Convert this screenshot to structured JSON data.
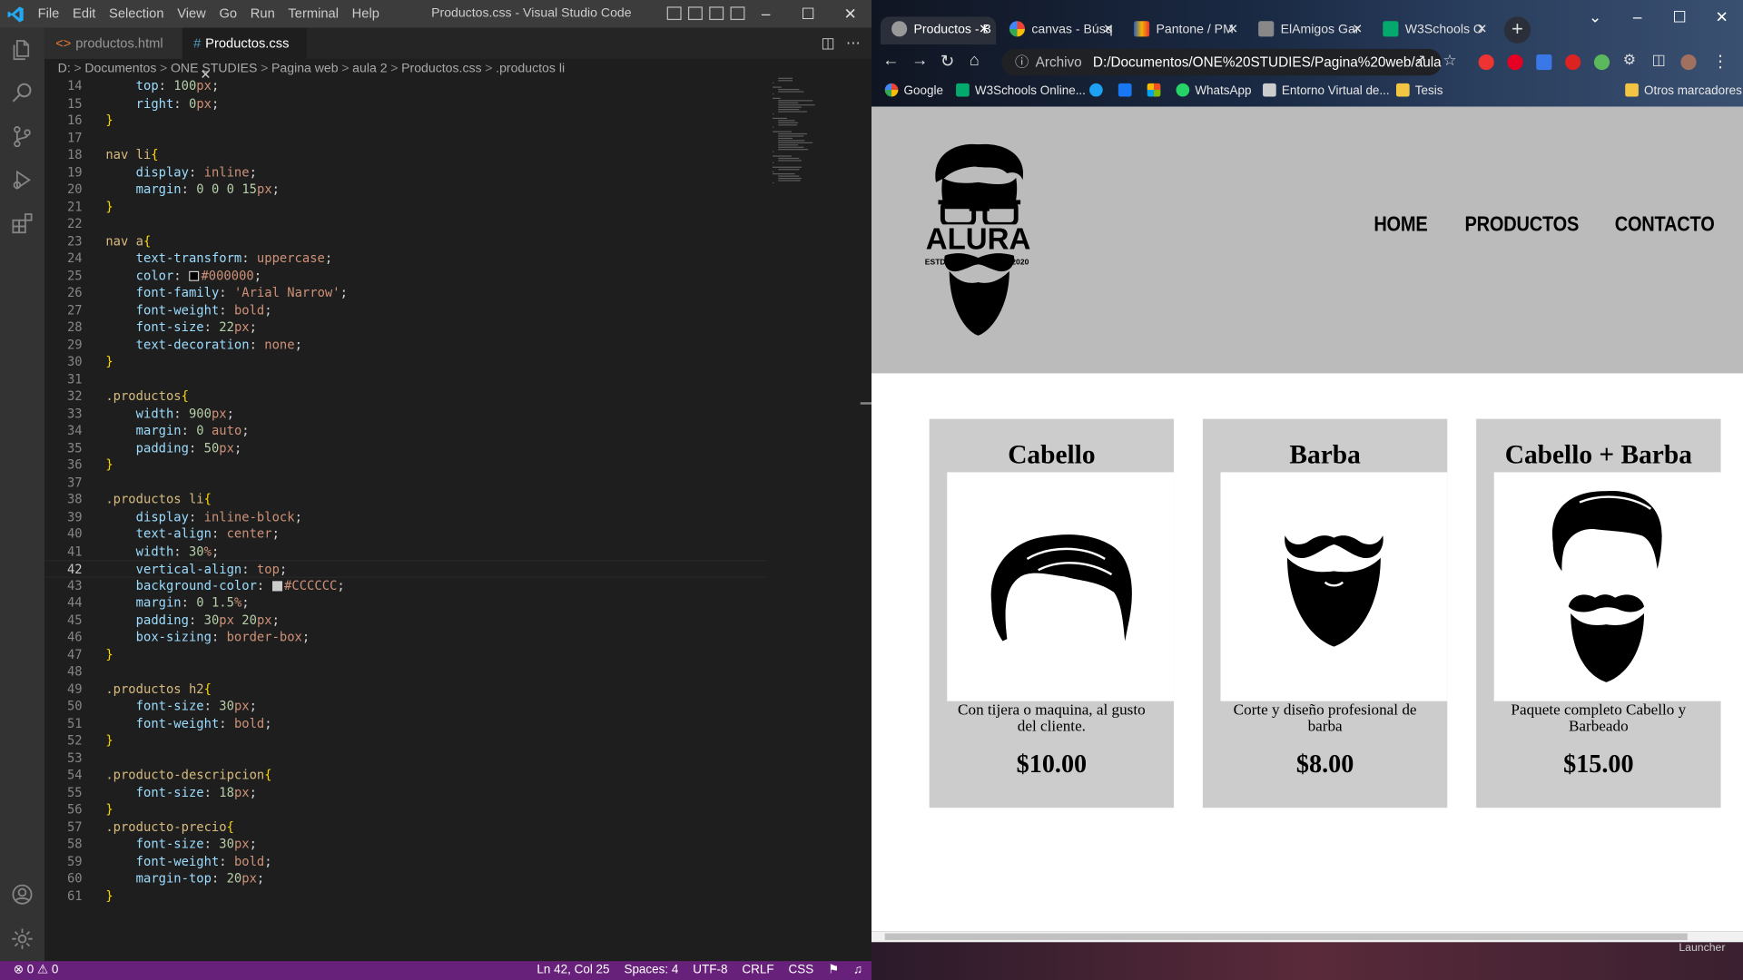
{
  "vscode": {
    "menu": [
      "File",
      "Edit",
      "Selection",
      "View",
      "Go",
      "Run",
      "Terminal",
      "Help"
    ],
    "window_title": "Productos.css - Visual Studio Code",
    "tabs": [
      {
        "label": "productos.html"
      },
      {
        "label": "Productos.css"
      }
    ],
    "breadcrumb": [
      "D:",
      "Documentos",
      "ONE STUDIES",
      "Pagina web",
      "aula 2",
      "Productos.css",
      ".productos li"
    ],
    "code": [
      {
        "n": "14",
        "text": "    top: 100px;"
      },
      {
        "n": "15",
        "text": "    right: 0px;"
      },
      {
        "n": "16",
        "text": "}"
      },
      {
        "n": "17",
        "text": ""
      },
      {
        "n": "18",
        "text": "nav li{"
      },
      {
        "n": "19",
        "text": "    display: inline;"
      },
      {
        "n": "20",
        "text": "    margin: 0 0 0 15px;"
      },
      {
        "n": "21",
        "text": "}"
      },
      {
        "n": "22",
        "text": ""
      },
      {
        "n": "23",
        "text": "nav a{"
      },
      {
        "n": "24",
        "text": "    text-transform: uppercase;"
      },
      {
        "n": "25",
        "text": "    color: #000000;"
      },
      {
        "n": "26",
        "text": "    font-family: 'Arial Narrow';"
      },
      {
        "n": "27",
        "text": "    font-weight: bold;"
      },
      {
        "n": "28",
        "text": "    font-size: 22px;"
      },
      {
        "n": "29",
        "text": "    text-decoration: none;"
      },
      {
        "n": "30",
        "text": "}"
      },
      {
        "n": "31",
        "text": ""
      },
      {
        "n": "32",
        "text": ".productos{"
      },
      {
        "n": "33",
        "text": "    width: 900px;"
      },
      {
        "n": "34",
        "text": "    margin: 0 auto;"
      },
      {
        "n": "35",
        "text": "    padding: 50px;"
      },
      {
        "n": "36",
        "text": "}"
      },
      {
        "n": "37",
        "text": ""
      },
      {
        "n": "38",
        "text": ".productos li{"
      },
      {
        "n": "39",
        "text": "    display: inline-block;"
      },
      {
        "n": "40",
        "text": "    text-align: center;"
      },
      {
        "n": "41",
        "text": "    width: 30%;"
      },
      {
        "n": "42",
        "text": "    vertical-align: top;"
      },
      {
        "n": "43",
        "text": "    background-color: #CCCCCC;"
      },
      {
        "n": "44",
        "text": "    margin: 0 1.5%;"
      },
      {
        "n": "45",
        "text": "    padding: 30px 20px;"
      },
      {
        "n": "46",
        "text": "    box-sizing: border-box;"
      },
      {
        "n": "47",
        "text": "}"
      },
      {
        "n": "48",
        "text": ""
      },
      {
        "n": "49",
        "text": ".productos h2{"
      },
      {
        "n": "50",
        "text": "    font-size: 30px;"
      },
      {
        "n": "51",
        "text": "    font-weight: bold;"
      },
      {
        "n": "52",
        "text": "}"
      },
      {
        "n": "53",
        "text": ""
      },
      {
        "n": "54",
        "text": ".producto-descripcion{"
      },
      {
        "n": "55",
        "text": "    font-size: 18px;"
      },
      {
        "n": "56",
        "text": "}"
      },
      {
        "n": "57",
        "text": ".producto-precio{"
      },
      {
        "n": "58",
        "text": "    font-size: 30px;"
      },
      {
        "n": "59",
        "text": "    font-weight: bold;"
      },
      {
        "n": "60",
        "text": "    margin-top: 20px;"
      },
      {
        "n": "61",
        "text": "}"
      }
    ],
    "current_line": "42",
    "status": {
      "errors": "0",
      "warnings": "0",
      "position": "Ln 42, Col 25",
      "spaces": "Spaces: 4",
      "encoding": "UTF-8",
      "eol": "CRLF",
      "language": "CSS"
    },
    "colors": {
      "statusbar": "#68217a",
      "editor_bg": "#1e1e1e"
    }
  },
  "chrome": {
    "tabs": [
      {
        "label": "Productos - B"
      },
      {
        "label": "canvas - Búsq"
      },
      {
        "label": "Pantone / PM"
      },
      {
        "label": "ElAmigos Gar"
      },
      {
        "label": "W3Schools O"
      }
    ],
    "address": {
      "scheme_label": "Archivo",
      "url": "D:/Documentos/ONE%20STUDIES/Pagina%20web/aula..."
    },
    "bookmarks": [
      "Google",
      "W3Schools Online...",
      "WhatsApp",
      "Entorno Virtual de...",
      "Tesis",
      "Otros marcadores"
    ],
    "bottom_label": "Launcher"
  },
  "site": {
    "logo": {
      "brand": "ALURA",
      "left": "ESTD",
      "right": "2020"
    },
    "nav": [
      "HOME",
      "PRODUCTOS",
      "CONTACTO"
    ],
    "products": [
      {
        "title": "Cabello",
        "description": "Con tijera o maquina, al gusto del cliente.",
        "price": "$10.00",
        "icon": "hair-icon"
      },
      {
        "title": "Barba",
        "description": "Corte y diseño profesional de barba",
        "price": "$8.00",
        "icon": "beard-icon"
      },
      {
        "title": "Cabello + Barba",
        "description": "Paquete completo Cabello y Barbeado",
        "price": "$15.00",
        "icon": "hair-beard-icon"
      }
    ],
    "colors": {
      "header_bg": "#bbbbbb",
      "card_bg": "#cccccc"
    }
  }
}
